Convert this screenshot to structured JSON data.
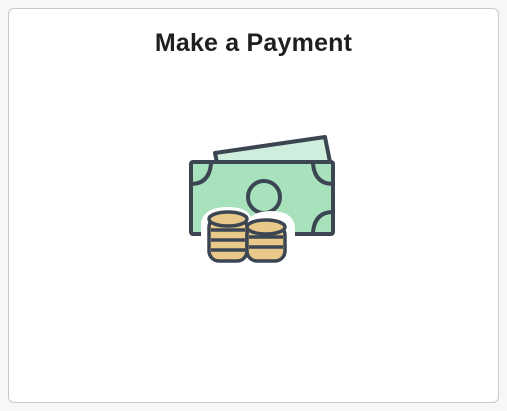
{
  "tile": {
    "title": "Make a Payment",
    "icon": "money-payment-icon"
  },
  "colors": {
    "bill_green": "#a8e2bd",
    "bill_outline": "#3c4652",
    "coin_gold": "#e8c98a",
    "tile_border": "#c9c9c9"
  }
}
